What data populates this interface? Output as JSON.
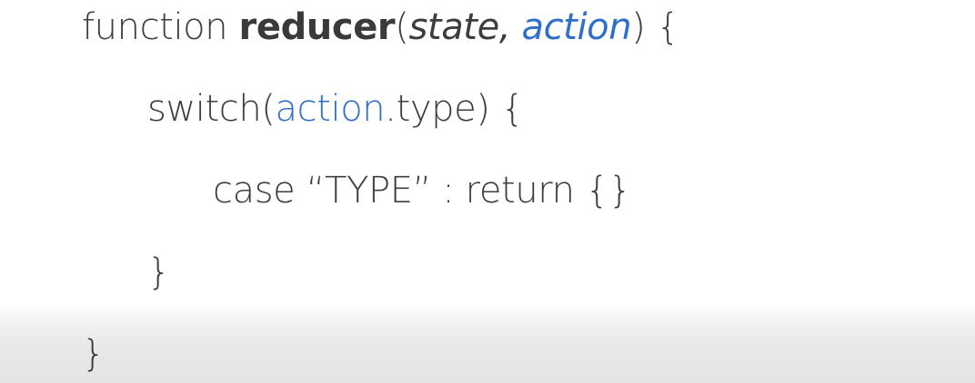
{
  "code": {
    "line1": {
      "keyword": "function ",
      "name": "reducer",
      "open_paren": "(",
      "param1": "state",
      "comma": ", ",
      "param2": "action",
      "close": ") {"
    },
    "line2": {
      "keyword": "switch(",
      "object": "action",
      "rest": ".type) {"
    },
    "line3": {
      "text": "case “TYPE” : return {}"
    },
    "line4": {
      "text": "}"
    },
    "line5": {
      "text": "}"
    }
  },
  "colors": {
    "text": "#3d3d3d",
    "accent": "#2f6fcb",
    "background": "#ffffff",
    "bottom_band": "#e4e4e4"
  }
}
